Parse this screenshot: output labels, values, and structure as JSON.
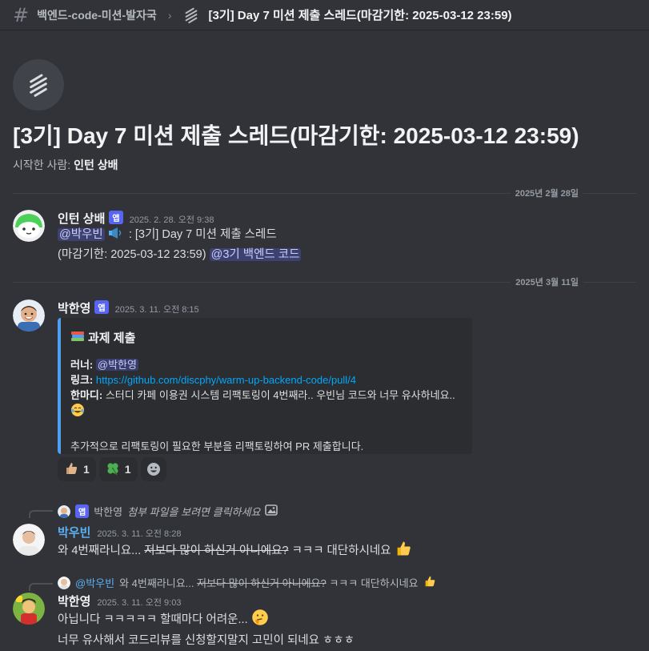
{
  "topbar": {
    "channel": "백엔드-code-미션-발자국",
    "separator": "›",
    "thread_title": "[3기] Day 7 미션 제출 스레드(마감기한: 2025-03-12 23:59)"
  },
  "thread": {
    "heading": "[3기] Day 7 미션 제출 스레드(마감기한: 2025-03-12 23:59)",
    "started_by_label": "시작한 사람:",
    "started_by_name": "인턴 상배"
  },
  "dividers": [
    "2025년 2월 28일",
    "2025년 3월 11일"
  ],
  "messages": [
    {
      "author": "인턴 상배",
      "badge": "앱",
      "time": "2025. 2. 28. 오전 9:38",
      "mention1": "@박우빈",
      "line1_rest": ": [3기] Day 7 미션 제출 스레드",
      "line2_prefix": "(마감기한: 2025-03-12 23:59)",
      "mention2": "@3기 백엔드 코드"
    },
    {
      "author": "박한영",
      "badge": "앱",
      "time": "2025. 3. 11. 오전 8:15",
      "embed": {
        "title": "과제 제출",
        "runner_label": "러너:",
        "runner_mention": "@박한영",
        "link_label": "링크:",
        "link_url": "https://github.com/discphy/warm-up-backend-code/pull/4",
        "comment_label": "한마디:",
        "comment_text": "스터디 카페 이용권 시스템 리팩토링이 4번째라.. 우빈님 코드와 너무 유사하네요..",
        "extra": "추가적으로 리팩토링이 필요한 부분을 리팩토링하여 PR 제출합니다."
      },
      "reactions": [
        {
          "icon": "thumbs-up",
          "count": "1"
        },
        {
          "icon": "four-leaf-clover",
          "count": "1"
        }
      ]
    },
    {
      "reply_badge": "앱",
      "reply_author": "박한영",
      "reply_text": "첨부 파일을 보려면 클릭하세요",
      "author": "박우빈",
      "time": "2025. 3. 11. 오전 8:28",
      "text_pre": "와 4번째라니요... ",
      "text_strike": "저보다 많이 하신거 아니에요?",
      "text_post": " ㅋㅋㅋ 대단하시네요"
    },
    {
      "reply_mention": "@박우빈",
      "reply_pre": "와 4번째라니요... ",
      "reply_strike": "저보다 많이 하신거 아니에요?",
      "reply_post": " ㅋㅋㅋ 대단하시네요",
      "author": "박한영",
      "time": "2025. 3. 11. 오전 9:03",
      "line1": "아닙니다 ㅋㅋㅋㅋㅋ 할때마다 어려운...",
      "line2": "너무 유사해서 코드리뷰를 신청할지말지  고민이 되네요 ㅎㅎㅎ"
    }
  ],
  "colors": {
    "background": "#313338",
    "embed_bar": "#4e9ff0",
    "mention_bg": "#3c4270",
    "link": "#00a8fc",
    "badge": "#5865f2"
  }
}
